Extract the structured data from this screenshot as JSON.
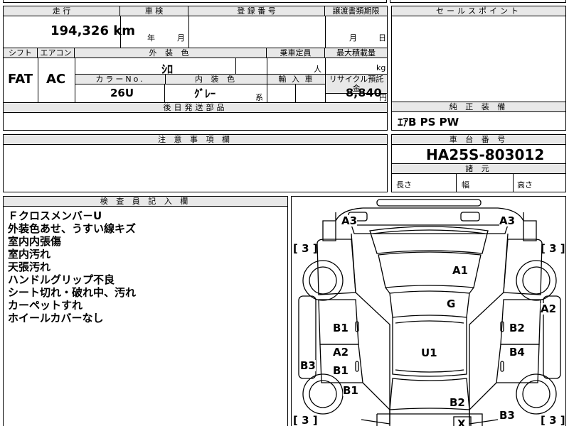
{
  "top_row": {
    "cut_text_1": "",
    "cut_text_2": ""
  },
  "mileage": {
    "label": "走 行",
    "value": "194,326 km"
  },
  "inspection": {
    "label": "車 検",
    "year_unit": "年",
    "month_unit": "月"
  },
  "registration": {
    "label": "登 録 番 号"
  },
  "transfer_docs": {
    "label": "譲渡書類期限",
    "month_unit": "月",
    "day_unit": "日"
  },
  "sales_points": {
    "label": "セールスポイント"
  },
  "shift": {
    "label": "シフト",
    "value": "FAT"
  },
  "aircon": {
    "label": "エアコン",
    "value": "AC"
  },
  "exterior_color": {
    "label": "外 装 色",
    "value": "ｼﾛ"
  },
  "capacity": {
    "label": "乗車定員",
    "unit": "人"
  },
  "max_load": {
    "label": "最大積載量",
    "unit": "kg"
  },
  "color_no": {
    "label": "カラーNo.",
    "value": "26U"
  },
  "interior_color": {
    "label": "内 装 色",
    "value": "ｸﾞﾚｰ",
    "suffix": "系"
  },
  "import_car": {
    "label": "輸 入 車"
  },
  "recycle": {
    "label": "リサイクル預託金",
    "value": "8,840",
    "unit": "円"
  },
  "later_parts": {
    "label": "後日発送部品"
  },
  "genuine_equipment": {
    "label": "純 正 装 備",
    "value": "ｴｱB PS PW"
  },
  "caution": {
    "label": "注 意 事 項 欄"
  },
  "chassis": {
    "label": "車 台 番 号",
    "value": "HA25S-803012"
  },
  "dimensions": {
    "label": "諸 元",
    "length": "長さ",
    "width": "幅",
    "height": "高さ"
  },
  "inspector": {
    "label": "検 査 員 記 入 欄",
    "notes": [
      "Ｆクロスメンバ－U",
      "外装色あせ、うすい線キズ",
      "室内内張傷",
      "室内汚れ",
      "天張汚れ",
      "ハンドルグリップ不良",
      "シート切れ・破れ中、汚れ",
      "カーペットすれ",
      "ホイールカバーなし"
    ]
  },
  "diagram": {
    "codes": {
      "a3_left": "A3",
      "a3_right": "A3",
      "a1": "A1",
      "g": "G",
      "a2_right": "A2",
      "b1_mid": "B1",
      "b2_right": "B2",
      "a2_left": "A2",
      "u1": "U1",
      "b4": "B4",
      "b3_left": "B3",
      "b1_lower": "B1",
      "b1_bottom": "B1",
      "b2_bottom": "B2",
      "b3_bottom": "B3",
      "x": "X"
    },
    "brackets": {
      "fl": "[ 3 ]",
      "fr": "[ 3 ]",
      "rl": "[ 3 ]",
      "rr": "[ 3 ]"
    }
  }
}
